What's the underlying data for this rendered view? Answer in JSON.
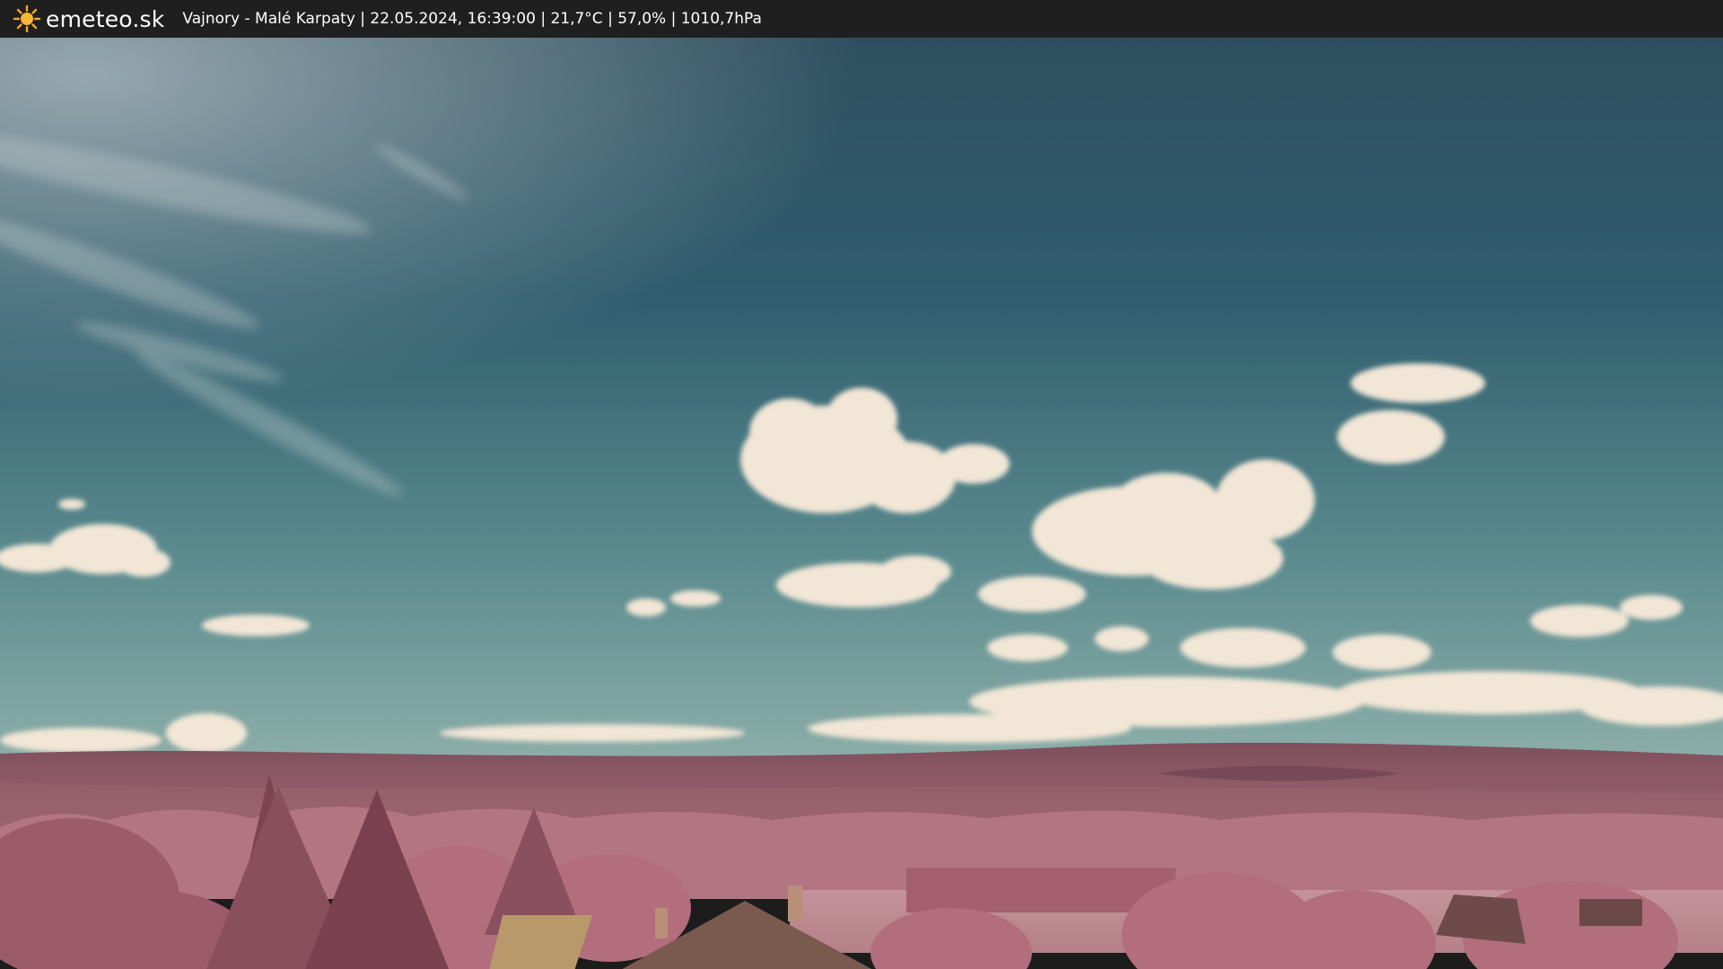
{
  "header": {
    "brand": "emeteo.sk",
    "logo_icon": "sun-icon",
    "caption": "Vajnory - Malé Karpaty | 22.05.2024, 16:39:00 | 21,7°C | 57,0% | 1010,7hPa"
  },
  "colors": {
    "bar_background": "#1f1f1f",
    "logo_sun": "#f5a623",
    "sky_top": "#2f5466",
    "sky_horizon": "#7aa3a3",
    "cloud": "#f2e6d6",
    "foliage_infrared": "#b9707f",
    "hills": "#8f5a66"
  }
}
